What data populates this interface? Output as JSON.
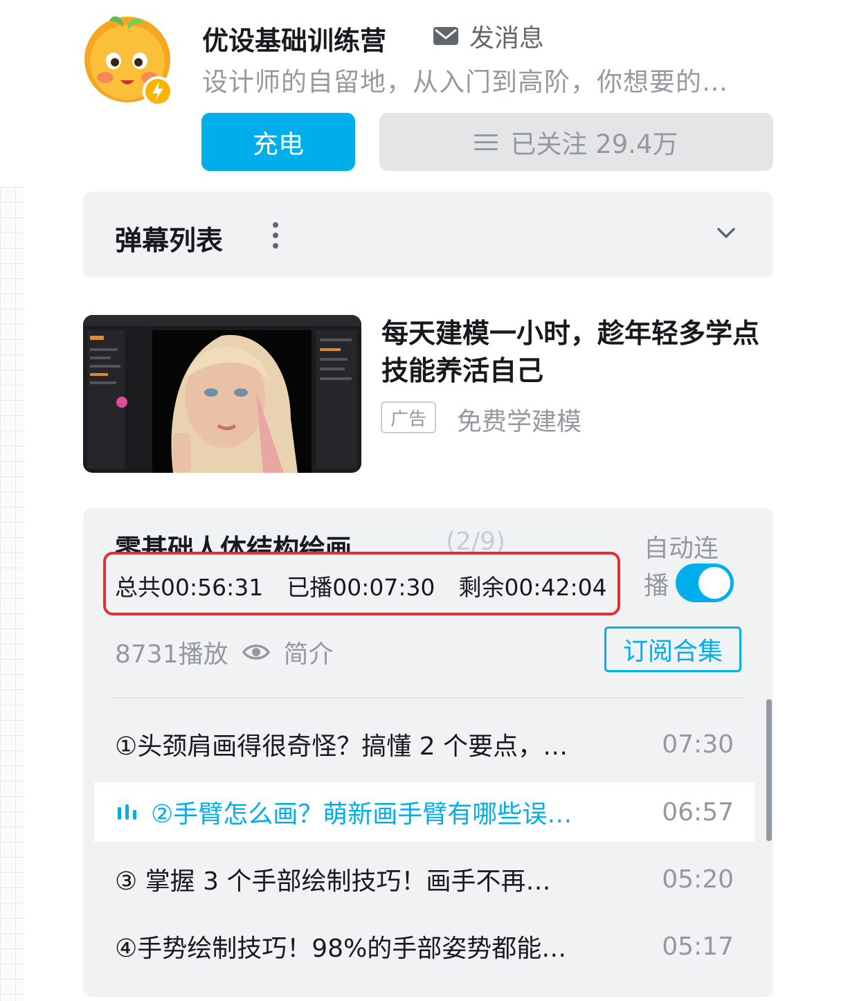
{
  "header": {
    "up_name": "优设基础训练营",
    "message_label": "发消息",
    "description": "设计师的自留地，从入门到高阶，你想要的…",
    "charge_label": "充电",
    "follow_label": "已关注 29.4万"
  },
  "danmaku": {
    "title": "弹幕列表"
  },
  "ad": {
    "title": "每天建模一小时，趁年轻多学点技能养活自己",
    "badge": "广告",
    "subtitle": "免费学建模"
  },
  "playlist": {
    "title": "零基础人体结构绘画…",
    "count": "(2/9)",
    "stats": {
      "total": "总共00:56:31",
      "played": "已播00:07:30",
      "remaining": "剩余00:42:04"
    },
    "autoplay_label": "自动连播",
    "autoplay_on": true,
    "plays": "8731播放",
    "intro_label": "简介",
    "subscribe_label": "订阅合集",
    "episodes": [
      {
        "title": "①头颈肩画得很奇怪？搞懂 2 个要点，…",
        "duration": "07:30"
      },
      {
        "title": "②手臂怎么画？萌新画手臂有哪些误…",
        "duration": "06:57",
        "active": true
      },
      {
        "title": "③ 掌握 3 个手部绘制技巧！画手不再…",
        "duration": "05:20"
      },
      {
        "title": "④手势绘制技巧！98%的手部姿势都能…",
        "duration": "05:17"
      }
    ]
  },
  "colors": {
    "accent": "#00aeec",
    "highlight_border": "#e0302f",
    "panel_bg": "#f1f2f3",
    "muted_text": "#9499a0"
  }
}
